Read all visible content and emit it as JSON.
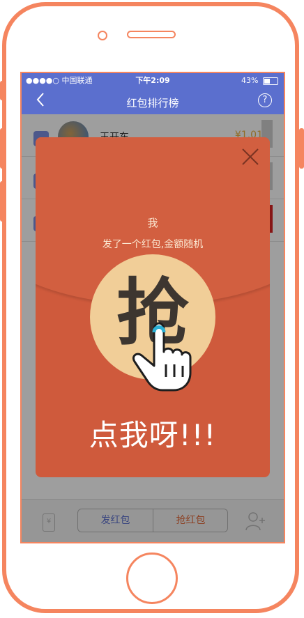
{
  "status_bar": {
    "carrier": "●●●●○ 中国联通",
    "time": "下午2:09",
    "battery": "43%",
    "battery_level": 0.43
  },
  "nav": {
    "title": "红包排行榜",
    "back_icon": "chevron-left-icon",
    "help_label": "?"
  },
  "list": {
    "rows": [
      {
        "name": "王开东",
        "amount": "¥1.01"
      },
      {
        "name": "",
        "amount": ""
      },
      {
        "name": "",
        "amount": ""
      }
    ]
  },
  "tabbar": {
    "wallet_icon_label": "¥",
    "send_label": "发红包",
    "grab_label": "抢红包",
    "add_user_icon": "add-user-icon"
  },
  "packet": {
    "sender": "我",
    "message": "发了一个红包,金额随机",
    "grab_char": "抢",
    "tap_text": "点我呀!!!",
    "close_icon": "close-icon"
  },
  "colors": {
    "accent": "#5b6fce",
    "packet_red": "#cf5a3c",
    "grab_circle": "#f1ce98",
    "frame": "#f5855f"
  }
}
